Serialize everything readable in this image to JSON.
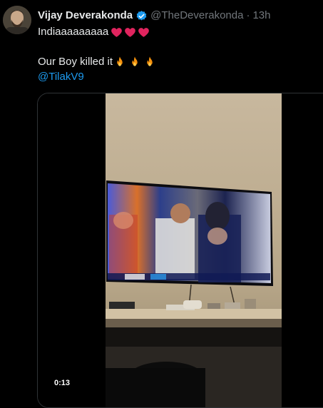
{
  "tweet": {
    "display_name": "Vijay Deverakonda",
    "handle": "@TheDeverakonda",
    "separator": "·",
    "time": "13h",
    "line1_text": "Indiaaaaaaaaa",
    "line1_emoji": [
      "red-heart",
      "red-heart",
      "red-heart"
    ],
    "line2_text": "Our Boy killed it",
    "line2_emoji": [
      "fire",
      "fire",
      "fire"
    ],
    "mention": "@TilakV9"
  },
  "media": {
    "type": "video",
    "timestamp": "0:13"
  },
  "colors": {
    "background": "#000000",
    "text": "#e7e9ea",
    "secondary": "#71767b",
    "link": "#1d9bf0",
    "verified": "#1d9bf0",
    "heart": "#f91880"
  }
}
